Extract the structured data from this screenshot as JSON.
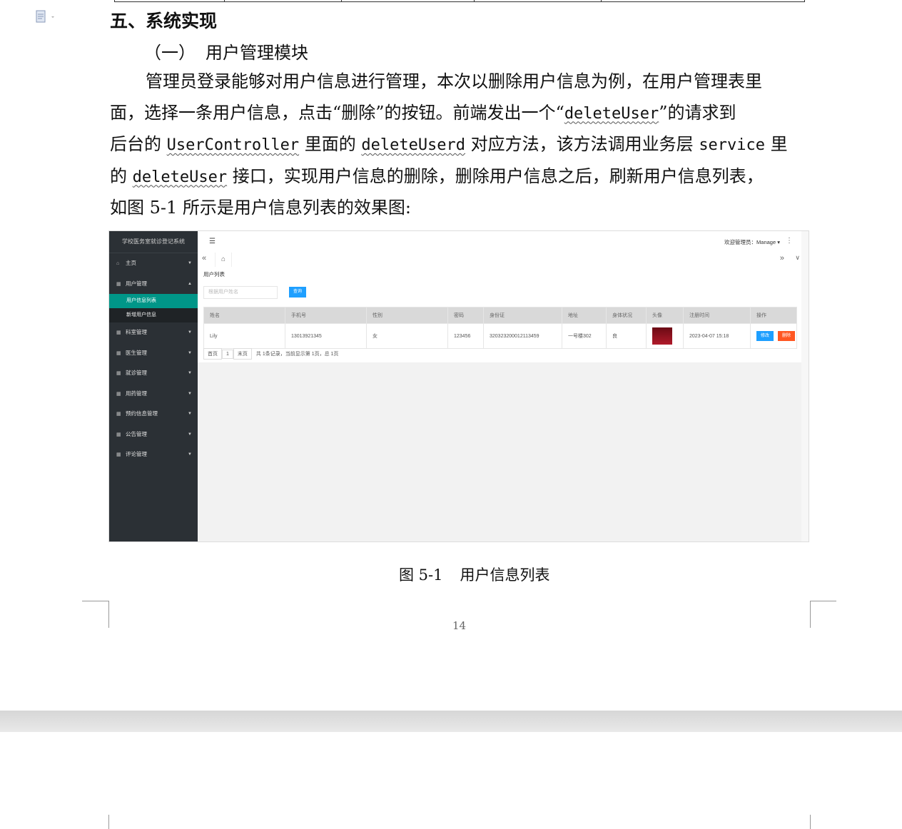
{
  "heading": "五、系统实现",
  "subheading": {
    "number": "（一）",
    "title": "用户管理模块"
  },
  "paragraph": {
    "line1": "管理员登录能够对用户信息进行管理，本次以删除用户信息为例，在用户管理表里",
    "line2a": "面，选择一条用户信息，点击“删除”的按钮。前端发出一个“",
    "line2code": "deleteUser",
    "line2b": "”的请求到",
    "line3a": "后台的 ",
    "line3code1": "UserController",
    "line3b": " 里面的 ",
    "line3code2": "deleteUserd",
    "line3c": " 对应方法，该方法调用业务层 ",
    "line3code3": "service",
    "line3d": " 里",
    "line4a": "的 ",
    "line4code": "deleteUser",
    "line4b": " 接口，实现用户信息的删除，删除用户信息之后，刷新用户信息列表，",
    "line5": "如图 5-1 所示是用户信息列表的效果图:"
  },
  "app": {
    "brand": "学校医务室就诊登记系统",
    "nav": {
      "home": "主页",
      "user_mgmt": "用户管理",
      "user_list": "用户信息列表",
      "add_user": "新增用户信息",
      "dept": "科室管理",
      "doctor": "医生管理",
      "visit": "就诊管理",
      "medicine": "用药管理",
      "appointment": "预约信息管理",
      "notice": "公告管理",
      "comment": "评论管理"
    },
    "welcome": "欢迎管理员：Manage",
    "page_title": "用户列表",
    "search_placeholder": "根据用户姓名",
    "search_button": "查询",
    "columns": [
      "姓名",
      "手机号",
      "性别",
      "密码",
      "身份证",
      "地址",
      "身体状况",
      "头像",
      "注册时间",
      "操作"
    ],
    "row": {
      "name": "Lily",
      "phone": "13013921345",
      "gender": "女",
      "password": "123456",
      "id_card": "320323200012113459",
      "address": "一号楼302",
      "health": "良",
      "registered": "2023-04-07 15:18",
      "edit": "修改",
      "delete": "删除"
    },
    "pager": {
      "first": "首页",
      "page": "1",
      "last": "末页",
      "info": "共 1条记录，当前显示第 1页，总 1页"
    }
  },
  "caption": {
    "label": "图 5-1",
    "text": "用户信息列表"
  },
  "page_number": "14"
}
